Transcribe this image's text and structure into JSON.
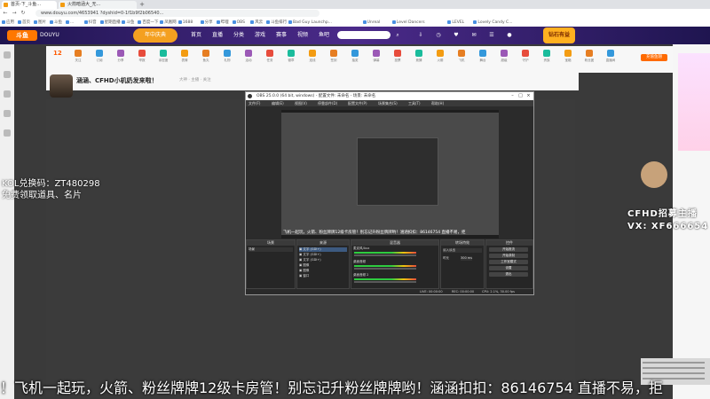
{
  "browser": {
    "tabs": [
      {
        "label": "首页-下_斗鱼..."
      },
      {
        "label": "火箭暗涵大_无..."
      }
    ],
    "url": "www.douyu.com/4653941 ?dyshid=0-1f1b9f2b06540...",
    "bookmarks": [
      "应用",
      "首页",
      "图片",
      "斗鱼",
      "...",
      "抖音",
      "星期直播",
      "斗鱼",
      "百度一下",
      "凤凰网",
      "1688",
      "分享",
      "哔哩",
      "OBS",
      "风云",
      "斗鱼排行",
      "Bad Guy Launchp...",
      "Unreal",
      "Level Dancers",
      "LEVEL",
      "Lovely Candy C..."
    ]
  },
  "site": {
    "logo": "斗鱼",
    "logo_sub": "DOUYU",
    "nav": [
      "首页",
      "直播",
      "分类",
      "游戏",
      "赛事",
      "视频",
      "鱼吧",
      "鱼乐"
    ],
    "center_badge": "年中庆典",
    "promo": "钻石有益"
  },
  "room": {
    "fans_count": "12",
    "toolbar_items": [
      "关注",
      "订阅",
      "分享",
      "举报",
      "亲密度",
      "表情",
      "鱼丸",
      "礼物",
      "活动",
      "任务",
      "徽章",
      "连线",
      "签到",
      "抽奖",
      "弹幕",
      "投票",
      "竞猜",
      "火箭",
      "飞机",
      "舞台",
      "超级",
      "守护",
      "贵族",
      "宝箱",
      "粉丝团",
      "直播间"
    ],
    "gift_button": "充值鱼翅",
    "anchor_title": "涵涵、CFHD小机奶发来啦！",
    "anchor_sub": "大神 · 主播 · 关注"
  },
  "overlay": {
    "kol_line1": "KOL兑换码：ZT480298",
    "kol_line2": "免费领取道具、名片",
    "marquee": "！飞机一起玩，火箭、粉丝牌牌12级卡房管！别忘记升粉丝牌牌哟！涵涵扣扣：86146754 直播不易，拒",
    "recruit_line1": "CFHD招募主播",
    "recruit_line2": "VX: XF666654"
  },
  "obs": {
    "title": "OBS 25.0.0 (64 bit, windows) - 配置文件: 未命名 - 场景: 未命名",
    "menu": [
      "文件(F)",
      "编辑(E)",
      "视图(V)",
      "停靠部件(D)",
      "配置文件(P)",
      "场景集合(S)",
      "工具(T)",
      "帮助(H)"
    ],
    "caption": "飞机一起玩，火箭、粉丝牌牌12级卡房管！别忘记升粉丝牌牌哟！涵涵扣扣：86146754 直播不易，拒",
    "docks": {
      "scenes": {
        "header": "场景",
        "items": [
          "场景"
        ]
      },
      "sources": {
        "header": "来源",
        "items": [
          "文字 (GDI+)",
          "文字 (GDI+)",
          "文字 (GDI+)",
          "图像",
          "图像",
          "窗口"
        ]
      },
      "mixer": {
        "header": "混音器",
        "channels": [
          "麦克风/Aux",
          "桌面音频",
          "桌面音频 2"
        ]
      },
      "transitions": {
        "header": "转场特效",
        "mode": "淡入淡出",
        "duration_label": "时长",
        "duration": "300 ms"
      },
      "controls": {
        "header": "控件",
        "buttons": [
          "开始推流",
          "开始录制",
          "工作室模式",
          "设置",
          "退出"
        ]
      }
    },
    "status": {
      "live": "LIVE: 00:00:00",
      "rec": "REC: 00:00:00",
      "cpu": "CPU: 2.1%, 30.00 fps"
    }
  }
}
